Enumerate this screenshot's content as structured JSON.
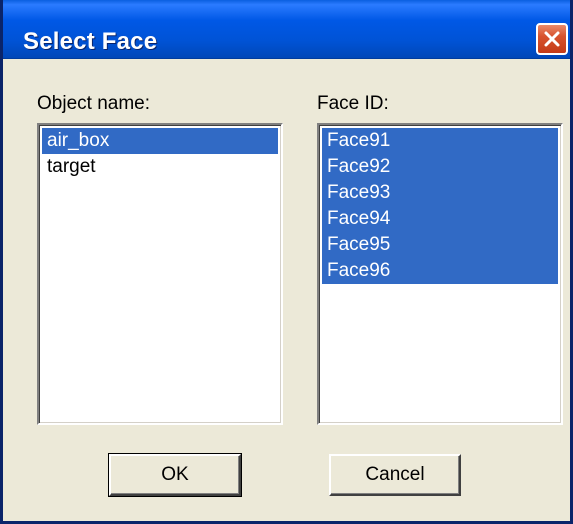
{
  "window": {
    "title": "Select Face"
  },
  "object_list": {
    "label": "Object name:",
    "items": [
      "air_box",
      "target"
    ],
    "selected": [
      "air_box"
    ]
  },
  "face_list": {
    "label": "Face ID:",
    "items": [
      "Face91",
      "Face92",
      "Face93",
      "Face94",
      "Face95",
      "Face96"
    ],
    "selected": [
      "Face91",
      "Face92",
      "Face93",
      "Face94",
      "Face95",
      "Face96"
    ]
  },
  "buttons": {
    "ok_label": "OK",
    "cancel_label": "Cancel"
  },
  "icons": {
    "close": "close-icon"
  },
  "colors": {
    "titlebar": "#0054e3",
    "selection": "#316ac5",
    "dialog_face": "#ece9d8",
    "close_button": "#d8532e"
  }
}
